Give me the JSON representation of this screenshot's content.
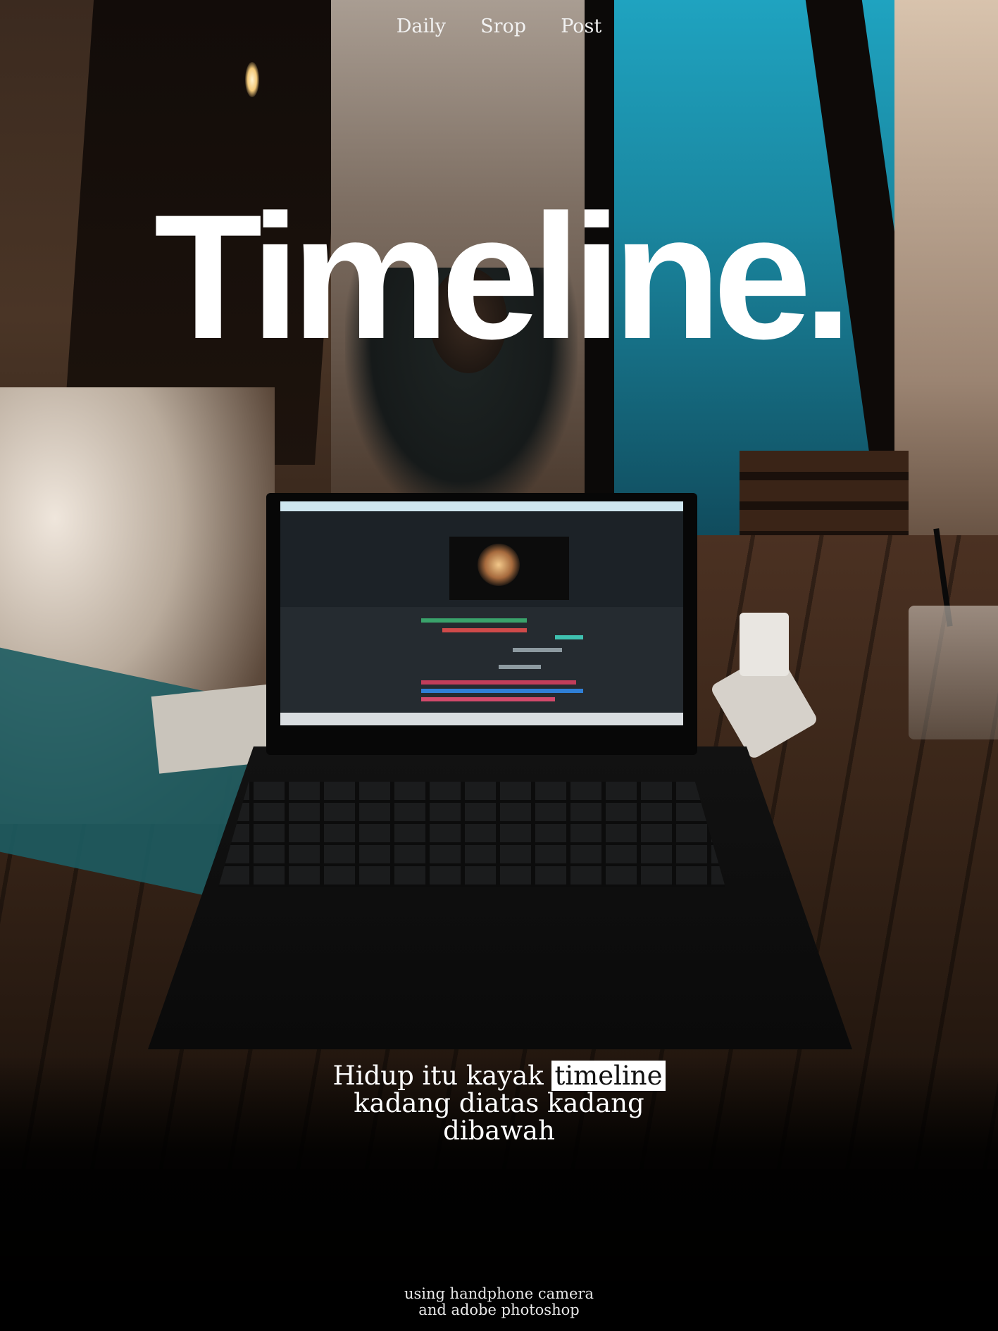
{
  "nav": {
    "items": [
      "Daily",
      "Srop",
      "Post"
    ]
  },
  "title": "Timeline.",
  "quote": {
    "line1_prefix": "Hidup itu kayak",
    "line1_highlight": "timeline",
    "line2": "kadang diatas kadang",
    "line3": "dibawah"
  },
  "footer": {
    "line1": "using handphone camera",
    "line2": "and adobe photoshop"
  },
  "colors": {
    "text": "#ffffff",
    "highlight_bg": "#ffffff",
    "highlight_text": "#111111",
    "accent_wall": "#1fa3c0"
  }
}
